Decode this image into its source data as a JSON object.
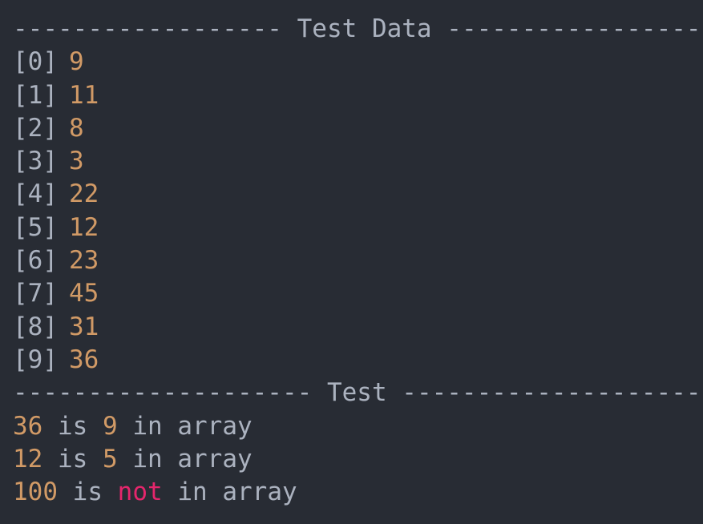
{
  "header1": {
    "left_rule": "------------------",
    "title": "Test Data",
    "right_rule": "------------------"
  },
  "items": [
    {
      "index": "[0]",
      "value": "9"
    },
    {
      "index": "[1]",
      "value": "11"
    },
    {
      "index": "[2]",
      "value": "8"
    },
    {
      "index": "[3]",
      "value": "3"
    },
    {
      "index": "[4]",
      "value": "22"
    },
    {
      "index": "[5]",
      "value": "12"
    },
    {
      "index": "[6]",
      "value": "23"
    },
    {
      "index": "[7]",
      "value": "45"
    },
    {
      "index": "[8]",
      "value": "31"
    },
    {
      "index": "[9]",
      "value": "36"
    }
  ],
  "header2": {
    "left_rule": "--------------------",
    "title": "Test",
    "right_rule": "--------------------"
  },
  "results": [
    {
      "target": "36",
      "is": "is",
      "position": "9",
      "suffix": "in array"
    },
    {
      "target": "12",
      "is": "is",
      "position": "5",
      "suffix": "in array"
    },
    {
      "target": "100",
      "is": "is",
      "negation": "not",
      "suffix": "in array"
    }
  ],
  "colors": {
    "background": "#282c34",
    "text": "#abb2bf",
    "number": "#d19a66",
    "negation": "#e5266c"
  }
}
